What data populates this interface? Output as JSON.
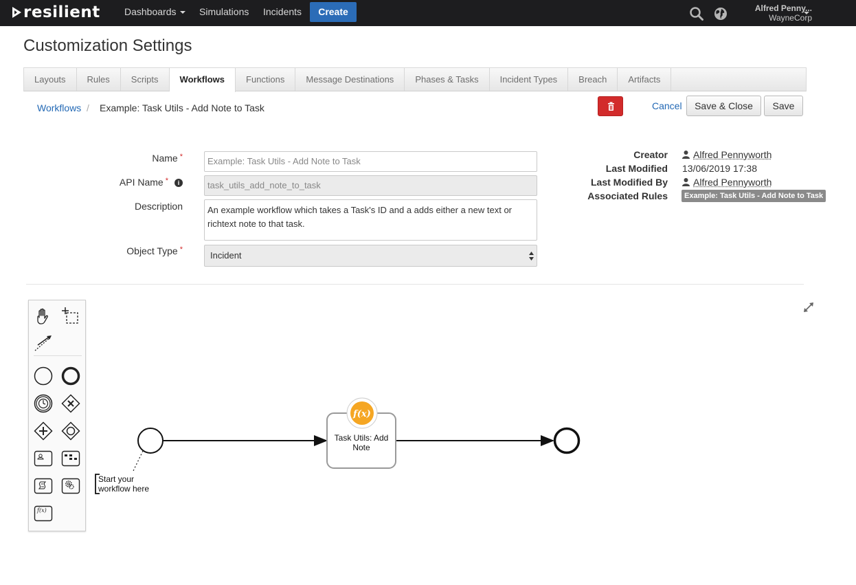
{
  "topbar": {
    "brand": "resilient",
    "nav": [
      {
        "label": "Dashboards",
        "dropdown": true
      },
      {
        "label": "Simulations"
      },
      {
        "label": "Incidents"
      }
    ],
    "create_label": "Create",
    "user_name": "Alfred Penny...",
    "user_org": "WayneCorp"
  },
  "page": {
    "title": "Customization Settings"
  },
  "tabs": [
    {
      "label": "Layouts"
    },
    {
      "label": "Rules"
    },
    {
      "label": "Scripts"
    },
    {
      "label": "Workflows",
      "active": true
    },
    {
      "label": "Functions"
    },
    {
      "label": "Message Destinations"
    },
    {
      "label": "Phases & Tasks"
    },
    {
      "label": "Incident Types"
    },
    {
      "label": "Breach"
    },
    {
      "label": "Artifacts"
    }
  ],
  "breadcrumb": {
    "parent": "Workflows",
    "separator": "/",
    "current": "Example: Task Utils - Add Note to Task"
  },
  "actions": {
    "cancel": "Cancel",
    "save_close": "Save & Close",
    "save": "Save"
  },
  "form": {
    "name_label": "Name",
    "name_placeholder": "Example: Task Utils - Add Note to Task",
    "api_label": "API Name",
    "api_value": "task_utils_add_note_to_task",
    "desc_label": "Description",
    "desc_value": "An example workflow which takes a Task's ID and a adds either a new text or richtext note to that task.",
    "type_label": "Object Type",
    "type_value": "Incident",
    "required_mark": "*"
  },
  "meta": {
    "creator_label": "Creator",
    "creator": "Alfred Pennyworth",
    "modified_label": "Last Modified",
    "modified": "13/06/2019 17:38",
    "modified_by_label": "Last Modified By",
    "modified_by": "Alfred Pennyworth",
    "rules_label": "Associated Rules",
    "rule": "Example: Task Utils - Add Note to Task"
  },
  "diagram": {
    "task_label_1": "Task Utils: Add",
    "task_label_2": "Note",
    "annotation_1": "Start your",
    "annotation_2": "workflow here",
    "function_glyph": "f(x)"
  },
  "colors": {
    "accent": "#2b6cb7",
    "danger": "#d22b2b",
    "function": "#f5a623"
  }
}
